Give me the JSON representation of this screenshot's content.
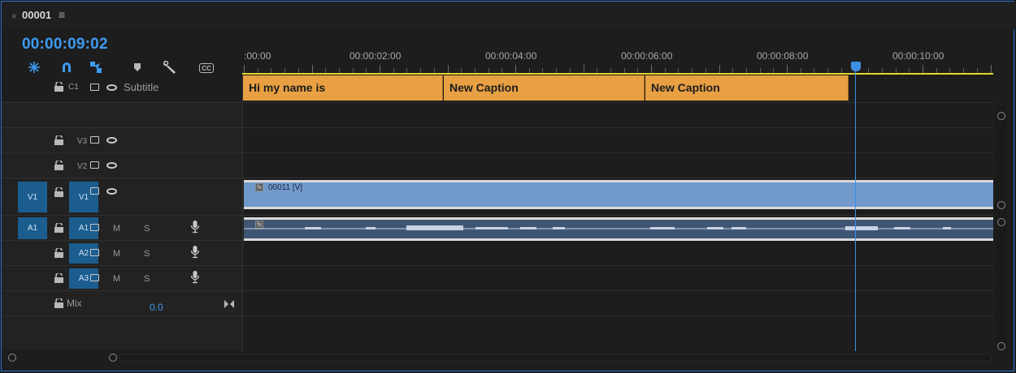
{
  "tab": {
    "close": "×",
    "title": "00001",
    "menu": "≡"
  },
  "timecode": "00:00:09:02",
  "toolbar": {
    "items": [
      {
        "name": "snap-settings-icon",
        "glyph": "✳"
      },
      {
        "name": "magnet-icon",
        "glyph": "∩"
      },
      {
        "name": "linked-selection-icon",
        "glyph": "⬔"
      },
      {
        "name": "add-marker-icon",
        "glyph": "▾"
      },
      {
        "name": "wrench-icon",
        "glyph": "🔧"
      }
    ],
    "cc_label": "CC"
  },
  "ruler": {
    "labels": [
      ":00:00",
      "00:00:02:00",
      "00:00:04:00",
      "00:00:06:00",
      "00:00:08:00",
      "00:00:10:00"
    ]
  },
  "subtitle_track": {
    "lock": "🔓",
    "id": "C1",
    "name": "Subtitle"
  },
  "captions": [
    {
      "text": "Hi my name is"
    },
    {
      "text": "New Caption"
    },
    {
      "text": "New Caption"
    }
  ],
  "video_tracks": [
    {
      "id": "V3",
      "source": ""
    },
    {
      "id": "V2",
      "source": ""
    },
    {
      "id": "V1",
      "source": "V1"
    }
  ],
  "audio_tracks": [
    {
      "id": "A1",
      "source": "A1",
      "m": "M",
      "s": "S"
    },
    {
      "id": "A2",
      "source": "",
      "m": "M",
      "s": "S"
    },
    {
      "id": "A3",
      "source": "",
      "m": "M",
      "s": "S"
    }
  ],
  "mix": {
    "label": "Mix",
    "value": "0.0"
  },
  "clips": {
    "video": {
      "fx": "fx",
      "name": "00011 [V]"
    },
    "audio": {
      "fx": "fx"
    }
  },
  "colors": {
    "accent": "#3d9bf0",
    "caption": "#e8a043",
    "video_clip": "#7199cc",
    "audio_clip": "#3e5573"
  }
}
